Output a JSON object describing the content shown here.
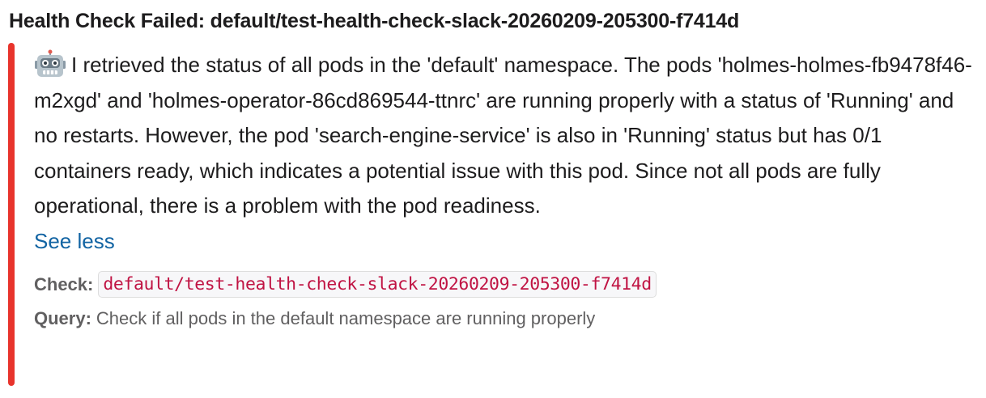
{
  "header": {
    "title": "Health Check Failed: default/test-health-check-slack-20260209-205300-f7414d"
  },
  "attachment": {
    "status_color": "#e8342c",
    "icon": "robot-face-icon",
    "message": "I retrieved the status of all pods in the 'default' namespace. The pods 'holmes-holmes-fb9478f46-m2xgd' and 'holmes-operator-86cd869544-ttnrc' are running properly with a status of 'Running' and no restarts. However, the pod 'search-engine-service' is also in 'Running' status but has 0/1 containers ready, which indicates a potential issue with this pod. Since not all pods are fully operational, there is a problem with the pod readiness.",
    "see_less_label": "See less",
    "fields": {
      "check_label": "Check:",
      "check_value": "default/test-health-check-slack-20260209-205300-f7414d",
      "query_label": "Query:",
      "query_value": "Check if all pods in the default namespace are running properly"
    }
  }
}
